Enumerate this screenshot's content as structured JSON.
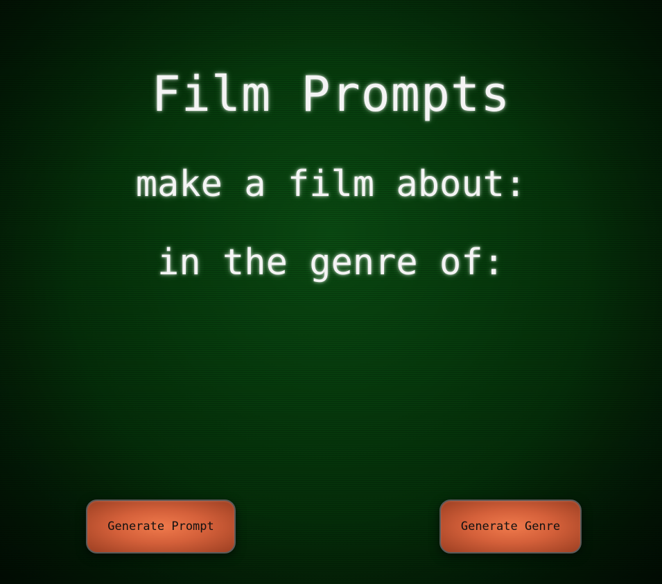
{
  "page": {
    "title": "Film Prompts",
    "prompt_line": "make a film about:",
    "genre_line": "in the genre of:"
  },
  "buttons": {
    "generate_prompt_label": "Generate Prompt",
    "generate_genre_label": "Generate Genre"
  },
  "colors": {
    "background": "#063a0c",
    "text": "#f4f4f4",
    "button": "#e06a40"
  }
}
